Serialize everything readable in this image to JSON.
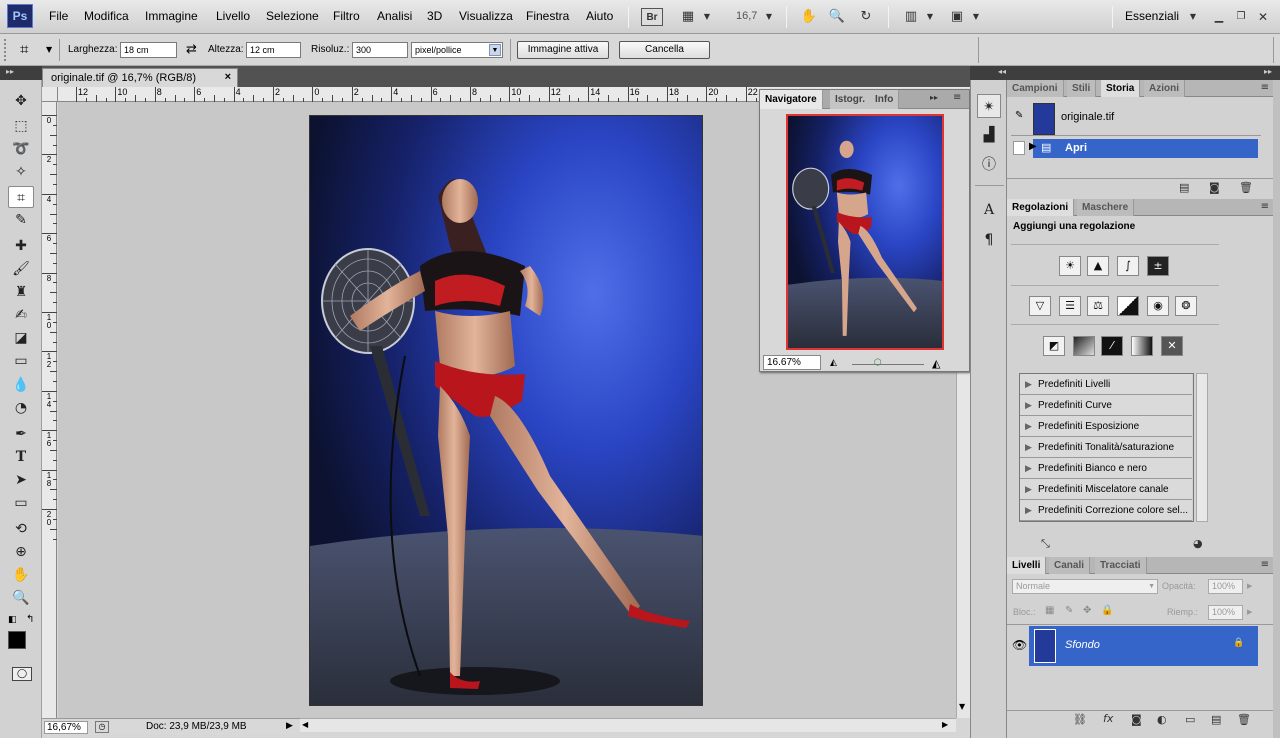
{
  "menubar": {
    "logo": "Ps",
    "items": [
      "File",
      "Modifica",
      "Immagine",
      "Livello",
      "Selezione",
      "Filtro",
      "Analisi",
      "3D",
      "Visualizza",
      "Finestra",
      "Aiuto"
    ],
    "bridge": "Br",
    "zoom": "16,7",
    "workspace": "Essenziali"
  },
  "options": {
    "width_label": "Larghezza:",
    "width_value": "18 cm",
    "height_label": "Altezza:",
    "height_value": "12 cm",
    "res_label": "Risoluz.:",
    "res_value": "300",
    "unit": "pixel/pollice",
    "front_image": "Immagine attiva",
    "clear": "Cancella"
  },
  "document": {
    "tab_title": "originale.tif @ 16,7% (RGB/8)",
    "ruler_h": [
      "12",
      "10",
      "8",
      "6",
      "4",
      "2",
      "0",
      "2",
      "4",
      "6",
      "8",
      "10",
      "12",
      "14",
      "16",
      "18",
      "20",
      "22"
    ],
    "ruler_v": [
      "0",
      "2",
      "4",
      "6",
      "8",
      "1 0",
      "1 2",
      "1 4",
      "1 6",
      "1 8",
      "2 0"
    ],
    "status_zoom": "16,67%",
    "status_doc": "Doc: 23,9 MB/23,9 MB"
  },
  "navigator": {
    "tabs": [
      "Navigatore",
      "Istogr.",
      "Info"
    ],
    "zoom": "16.67%"
  },
  "history": {
    "tabs": [
      "Campioni",
      "Stili",
      "Storia",
      "Azioni"
    ],
    "snapshot": "originale.tif",
    "step": "Apri"
  },
  "adjustments": {
    "tabs": [
      "Regolazioni",
      "Maschere"
    ],
    "heading": "Aggiungi una regolazione",
    "presets": [
      "Predefiniti Livelli",
      "Predefiniti Curve",
      "Predefiniti Esposizione",
      "Predefiniti Tonalità/saturazione",
      "Predefiniti Bianco e nero",
      "Predefiniti Miscelatore canale",
      "Predefiniti Correzione colore sel..."
    ]
  },
  "layers": {
    "tabs": [
      "Livelli",
      "Canali",
      "Tracciati"
    ],
    "blend_mode": "Normale",
    "opacity_label": "Opacità:",
    "opacity": "100%",
    "lock_label": "Bloc.:",
    "fill_label": "Riemp.:",
    "fill": "100%",
    "layer_name": "Sfondo"
  }
}
